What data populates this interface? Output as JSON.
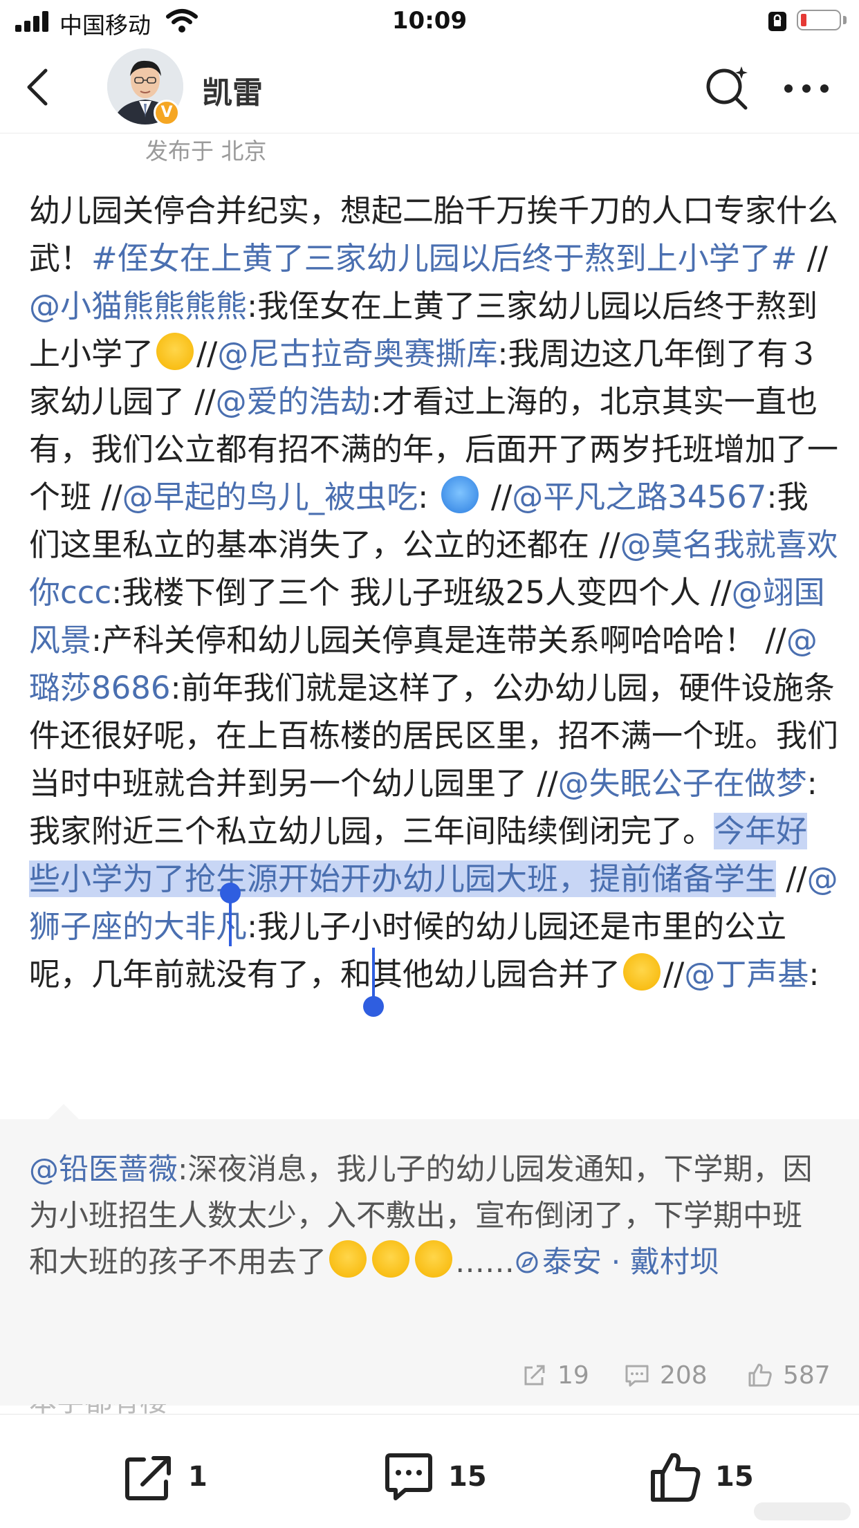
{
  "status_bar": {
    "carrier": "中国移动",
    "time": "10:09"
  },
  "header": {
    "user_name": "凯雷",
    "location": "发布于 北京"
  },
  "post": {
    "p1": "幼儿园关停合并纪实，想起二胎千万挨千刀的人口专家什么武！",
    "tag": "#侄女在上黄了三家幼儿园以后终于熬到上小学了#",
    "sep1": " //",
    "m1": "@小猫熊熊熊熊",
    "t1": ":我侄女在上黄了三家幼儿园以后终于熬到上小学了",
    "sep2": "//",
    "m2": "@尼古拉奇奥赛撕库",
    "t2": ":我周边这几年倒了有３家幼儿园了 //",
    "m3": "@爱的浩劫",
    "t3": ":才看过上海的，北京其实一直也有，我们公立都有招不满的年，后面开了两岁托班增加了一个班 //",
    "m4": "@早起的鸟儿_被虫吃",
    "t4": ": ",
    "sep4": " //",
    "m5": "@平凡之路34567",
    "t5": ":我们这里私立的基本消失了，公立的还都在 //",
    "m6": "@莫名我就喜欢你ccc",
    "t6": ":我楼下倒了三个  我儿子班级25人变四个人 //",
    "m7": "@翊国风景",
    "t7": ":产科关停和幼儿园关停真是连带关系啊哈哈哈！ //",
    "m8": "@璐莎8686",
    "t8": ":前年我们就是这样了，公办幼儿园，硬件设施条件还很好呢，在上百栋楼的居民区里，招不满一个班。我们当时中班就合并到另一个幼儿园里了 //",
    "m9": "@失眠公子在做梦",
    "t9": ":我家附近三个私立幼儿园，三年间陆续倒闭完了。",
    "selected": "今年好些小学为了抢生源开始开办幼儿园大班，提前储备学生",
    "sep10": " //",
    "m10": "@狮子座的大非凡",
    "t10": ":我儿子小时候的幼儿园还是市里的公立呢，几年前就没有了，和其他幼儿园合并了",
    "sep11": "//",
    "m11": "@丁声基",
    "t11": ":"
  },
  "repost": {
    "mention": "@铅医蔷薇",
    "text": ":深夜消息，我儿子的幼儿园发通知，下学期，因为小班招生人数太少，入不敷出，宣布倒闭了，下学期中班和大班的孩子不用去了",
    "ellipsis": "……",
    "location": "泰安 · 戴村坝",
    "reposts": "19",
    "comments": "208",
    "likes": "587"
  },
  "truncated_text": "本字都有楼",
  "bottom_bar": {
    "reposts": "1",
    "comments": "15",
    "likes": "15"
  },
  "colors": {
    "link": "#4a6fb0",
    "selection": "#c8d6f5",
    "handle": "#2f5ee0"
  },
  "icons": [
    "signal-icon",
    "wifi-icon",
    "lock-icon",
    "battery-icon",
    "back-icon",
    "verified-icon",
    "search-icon",
    "more-icon",
    "laugh-cry-emoji",
    "doraemon-emoji",
    "location-icon",
    "repost-icon",
    "comment-icon",
    "like-icon"
  ]
}
